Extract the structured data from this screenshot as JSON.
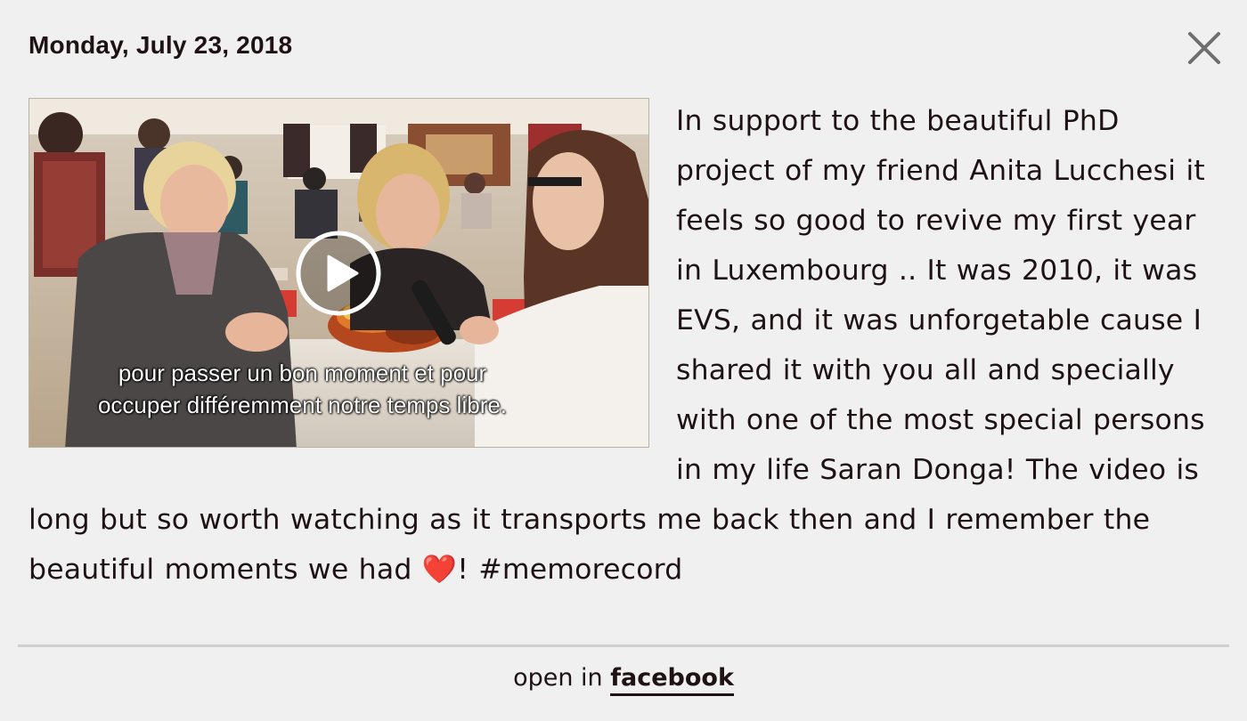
{
  "header": {
    "date": "Monday, July 23, 2018"
  },
  "close_icon": "close-x-icon",
  "video": {
    "subtitle_line1": "pour passer un bon moment et pour",
    "subtitle_line2": "occuper différemment notre temps libre.",
    "play_icon": "play-icon"
  },
  "post": {
    "text_before_heart": "In support to the beautiful PhD project of my friend Anita Lucchesi it feels so good to revive my first year in Luxembourg .. It was 2010, it was EVS, and it was unforgetable cause I shared it with you all and specially with one of the most special persons in my life Saran Donga! The video is long but so worth watching as it transports me back then and I remember the beautiful moments we had ",
    "heart": "❤️",
    "text_after_heart": "! #memorecord"
  },
  "footer": {
    "prefix": "open in ",
    "link_label": "facebook"
  },
  "colors": {
    "background": "#f0f0f0",
    "text": "#1e1215",
    "divider": "#cfcfcf"
  }
}
